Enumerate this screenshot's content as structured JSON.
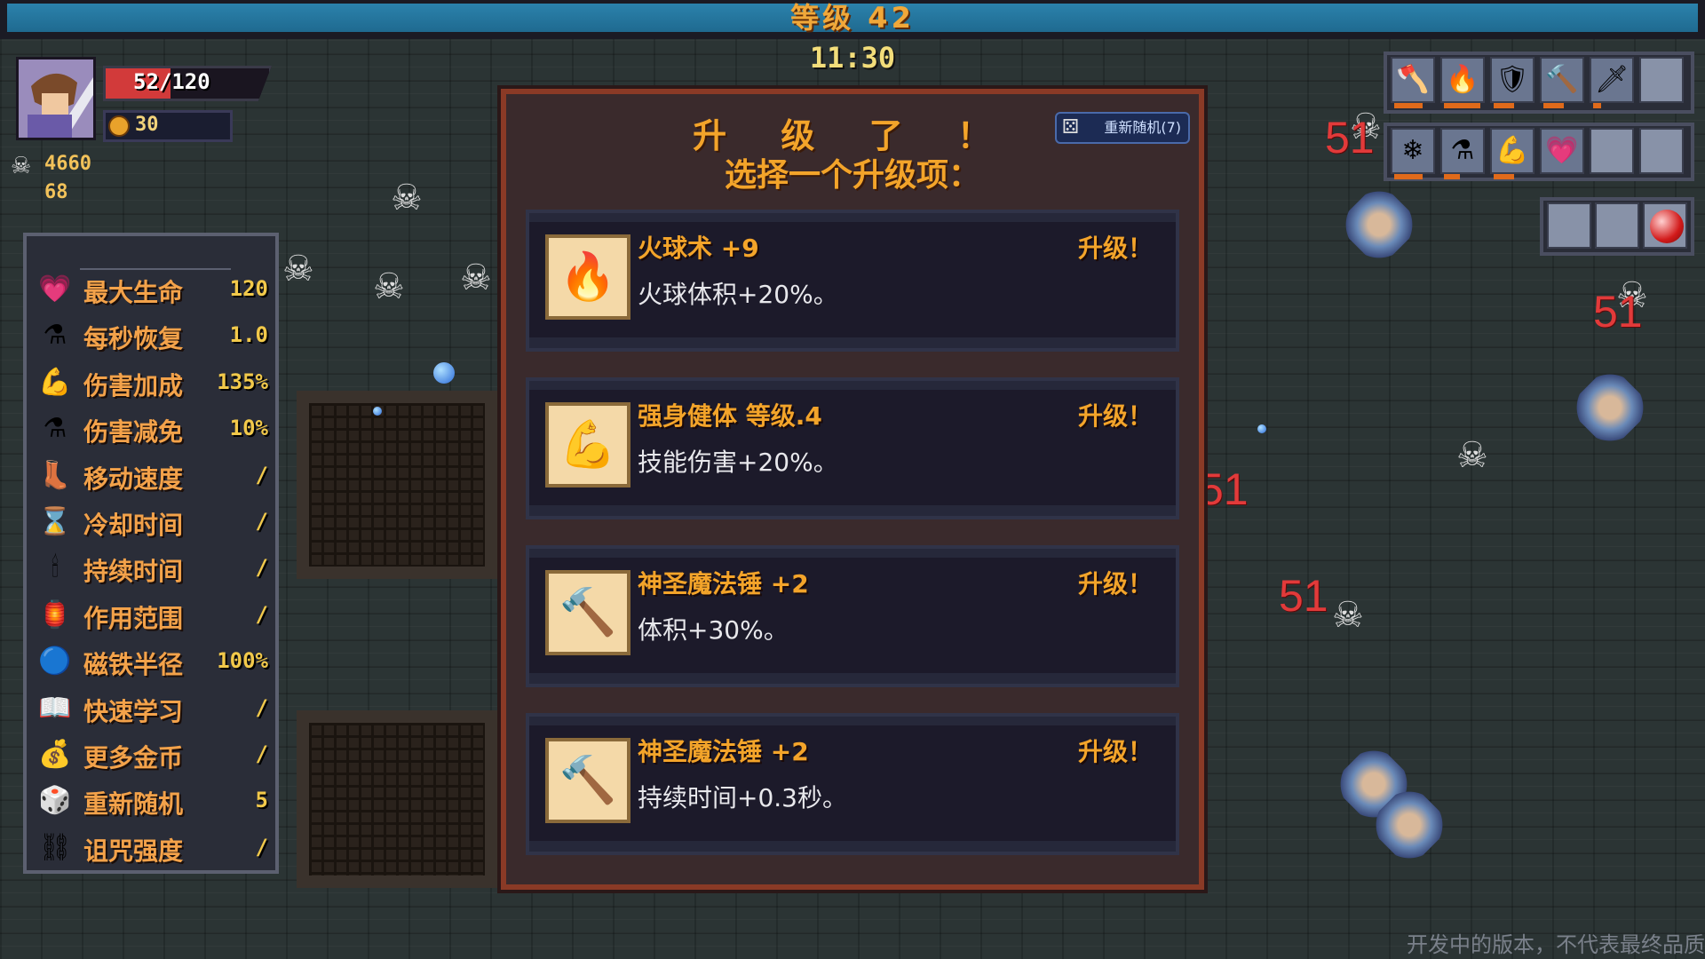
{
  "hud": {
    "level_label": "等级 42",
    "timer": "11:30",
    "hp_text": "52/120",
    "hp_fraction": 0.43,
    "gold": "30",
    "kills": "4660",
    "secondary_count": "68",
    "xp_fraction": 1.0
  },
  "stats": [
    {
      "icon": "heart-icon",
      "label": "最大生命",
      "value": "120"
    },
    {
      "icon": "potion-icon",
      "label": "每秒恢复",
      "value": "1.0"
    },
    {
      "icon": "muscle-icon",
      "label": "伤害加成",
      "value": "135%"
    },
    {
      "icon": "potion-icon",
      "label": "伤害减免",
      "value": "10%"
    },
    {
      "icon": "boots-icon",
      "label": "移动速度",
      "value": "/"
    },
    {
      "icon": "hourglass-icon",
      "label": "冷却时间",
      "value": "/"
    },
    {
      "icon": "candle-icon",
      "label": "持续时间",
      "value": "/"
    },
    {
      "icon": "lantern-icon",
      "label": "作用范围",
      "value": "/"
    },
    {
      "icon": "orb-icon",
      "label": "磁铁半径",
      "value": "100%"
    },
    {
      "icon": "book-icon",
      "label": "快速学习",
      "value": "/"
    },
    {
      "icon": "bag-icon",
      "label": "更多金币",
      "value": "/"
    },
    {
      "icon": "dice-icon",
      "label": "重新随机",
      "value": "5"
    },
    {
      "icon": "chain-icon",
      "label": "诅咒强度",
      "value": "/"
    }
  ],
  "modal": {
    "title": "升 级 了 ！",
    "subtitle": "选择一个升级项：",
    "reroll_label": "重新随机(7)",
    "options": [
      {
        "icon": "fireball-icon",
        "title": "火球术 +9",
        "badge": "升级！",
        "desc": "火球体积+20%。"
      },
      {
        "icon": "muscle-icon",
        "title": "强身健体 等级.4",
        "badge": "升级！",
        "desc": "技能伤害+20%。"
      },
      {
        "icon": "hammer-icon",
        "title": "神圣魔法锤 +2",
        "badge": "升级！",
        "desc": "体积+30%。"
      },
      {
        "icon": "hammer-icon",
        "title": "神圣魔法锤 +2",
        "badge": "升级！",
        "desc": "持续时间+0.3秒。"
      }
    ]
  },
  "inventory": {
    "weapons": [
      {
        "icon": "axe-icon",
        "glyph": "🪓",
        "level_fraction": 0.7
      },
      {
        "icon": "fireball-icon",
        "glyph": "🔥",
        "level_fraction": 0.9
      },
      {
        "icon": "shield-icon",
        "glyph": "🛡",
        "level_fraction": 0.5
      },
      {
        "icon": "hammer-icon",
        "glyph": "🔨",
        "level_fraction": 0.5
      },
      {
        "icon": "dagger-icon",
        "glyph": "🗡",
        "level_fraction": 0.2
      },
      {
        "icon": "empty-slot",
        "glyph": "",
        "level_fraction": 0
      }
    ],
    "passives": [
      {
        "icon": "snowflake-icon",
        "glyph": "❄",
        "level_fraction": 0.7
      },
      {
        "icon": "potion-icon",
        "glyph": "⚗",
        "level_fraction": 0.4
      },
      {
        "icon": "muscle-icon",
        "glyph": "💪",
        "level_fraction": 0.5
      },
      {
        "icon": "heart-icon",
        "glyph": "💗",
        "level_fraction": 0
      },
      {
        "icon": "empty-slot",
        "glyph": "",
        "level_fraction": 0
      },
      {
        "icon": "empty-slot",
        "glyph": "",
        "level_fraction": 0
      }
    ]
  },
  "floating_damage": [
    "51",
    "51",
    "51",
    "51"
  ],
  "watermark": "开发中的版本，不代表最终品质"
}
